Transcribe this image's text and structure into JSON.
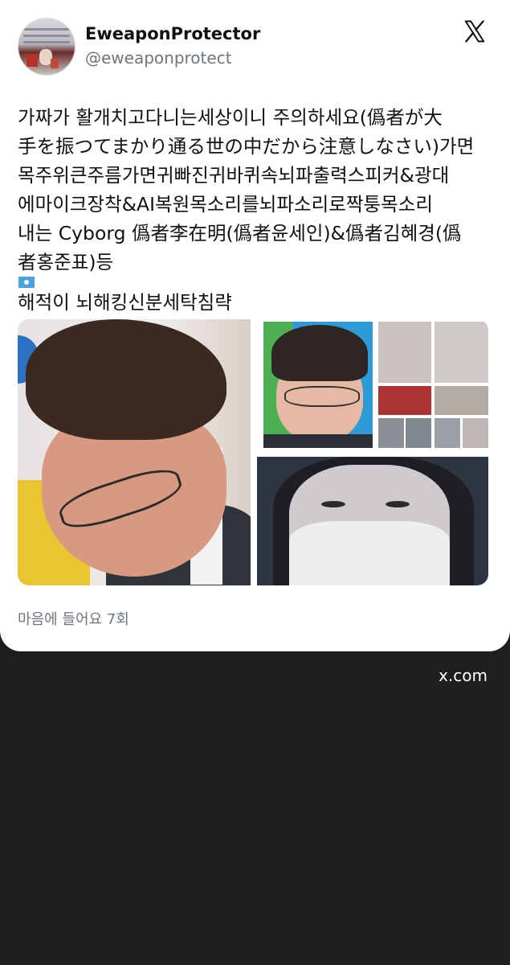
{
  "post": {
    "author_name": "EweaponProtector",
    "author_handle": "@eweaponprotect",
    "body_lines": [
      "가짜가 활개치고다니는세상이니 주의하세요(僞者が大",
      "手を振つてまかり通る世の中だから注意しなさい)가면",
      "목주위큰주름가면귀빠진귀바퀴속뇌파출력스피커&광대",
      "에마이크장착&AI복원목소리를뇌파소리로짝퉁목소리",
      "내는 Cyborg 僞者李在明(僞者윤세인)&僞者김혜경(僞",
      "者홍준표)등",
      "해적이 뇌해킹신분세탁침략"
    ],
    "likes": "마음에 들어요 7회"
  },
  "footer": {
    "domain": "x.com"
  },
  "icons": {
    "x_logo": "x-logo-icon",
    "flag": "flag-emoji-icon"
  },
  "colors": {
    "card_bg": "#ffffff",
    "page_bg": "#1e1e1e",
    "secondary_text": "#6e767d"
  }
}
